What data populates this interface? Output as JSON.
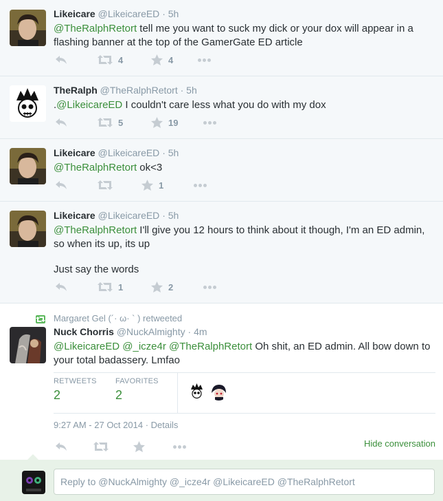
{
  "tweets": [
    {
      "name": "Likeicare",
      "handle": "@LikeicareED",
      "dot": "·",
      "time": "5h",
      "mention": "@TheRalphRetort",
      "text": " tell me you want to suck my dick or your dox will appear in a flashing banner at the top of the GamerGate ED article",
      "retweets": "4",
      "favorites": "4"
    },
    {
      "name": "TheRalph",
      "handle": "@TheRalphRetort",
      "dot": "·",
      "time": "5h",
      "prefix": ".",
      "mention": "@LikeicareED",
      "text": " I couldn't care less what you do with my dox",
      "retweets": "5",
      "favorites": "19"
    },
    {
      "name": "Likeicare",
      "handle": "@LikeicareED",
      "dot": "·",
      "time": "5h",
      "mention": "@TheRalphRetort",
      "text": " ok<3",
      "retweets": "",
      "favorites": "1"
    },
    {
      "name": "Likeicare",
      "handle": "@LikeicareED",
      "dot": "·",
      "time": "5h",
      "mention": "@TheRalphRetort",
      "text": " I'll give you 12 hours to think about it though, I'm an ED admin, so when its up, its up",
      "text2": "Just say the words",
      "retweets": "1",
      "favorites": "2"
    }
  ],
  "expanded": {
    "retweet_context": "Margaret Gel (´· ω· ` ) retweeted",
    "name": "Nuck Chorris",
    "handle": "@NuckAlmighty",
    "dot": "·",
    "time": "4m",
    "mentions": [
      "@LikeicareED",
      "@_icze4r",
      "@TheRalphRetort"
    ],
    "text": " Oh shit, an ED admin. All bow down to your total badassery. Lmfao",
    "retweets_label": "RETWEETS",
    "retweets": "2",
    "favorites_label": "FAVORITES",
    "favorites": "2",
    "timestamp": "9:27 AM - 27 Oct 2014",
    "details_sep": "·",
    "details": "Details",
    "hide_conversation": "Hide conversation"
  },
  "reply": {
    "placeholder": "Reply to @NuckAlmighty @_icze4r @LikeicareED @TheRalphRetort"
  },
  "colors": {
    "accent": "#3b8f3b",
    "muted": "#8899a6",
    "background": "#f5f8fa"
  }
}
